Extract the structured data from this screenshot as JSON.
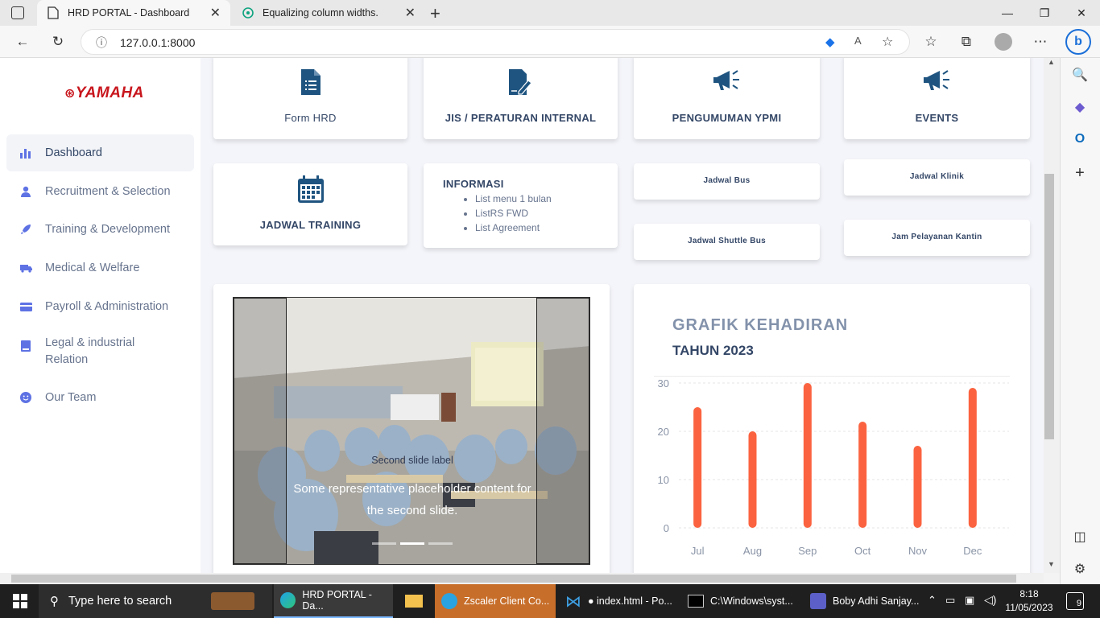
{
  "browser": {
    "tabs": [
      {
        "title": "HRD PORTAL - Dashboard",
        "active": true
      },
      {
        "title": "Equalizing column widths.",
        "active": false
      }
    ],
    "url": "127.0.0.1:8000",
    "url_port_suffix": ""
  },
  "sidebar": {
    "logo": "YAMAHA",
    "items": [
      {
        "label": "Dashboard",
        "icon": "bar-chart-icon",
        "active": true
      },
      {
        "label": "Recruitment & Selection",
        "icon": "person-icon"
      },
      {
        "label": "Training & Development",
        "icon": "rocket-icon"
      },
      {
        "label": "Medical & Welfare",
        "icon": "ambulance-icon"
      },
      {
        "label": "Payroll & Administration",
        "icon": "card-icon"
      },
      {
        "label": "Legal & industrial Relation",
        "icon": "book-icon"
      },
      {
        "label": "Our Team",
        "icon": "smile-icon"
      }
    ]
  },
  "cards": {
    "form_hrd": "Form HRD",
    "jis": "JIS / PERATURAN INTERNAL",
    "pengumuman": "PENGUMUMAN YPMI",
    "events": "EVENTS",
    "jadwal_training": "JADWAL TRAINING",
    "informasi": {
      "title": "INFORMASI",
      "items": [
        "List menu 1 bulan",
        "ListRS FWD",
        "List Agreement"
      ]
    },
    "jadwal_bus": "Jadwal Bus",
    "jadwal_klinik": "Jadwal Klinik",
    "jadwal_shuttle": "Jadwal Shuttle Bus",
    "jam_kantin": "Jam Pelayanan Kantin"
  },
  "carousel": {
    "label": "Second slide label",
    "caption": "Some representative placeholder content for the second slide.",
    "indicators": 3,
    "active_index": 1
  },
  "chart_data": {
    "type": "bar",
    "title": "GRAFIK KEHADIRAN",
    "subtitle": "TAHUN 2023",
    "categories": [
      "Jul",
      "Aug",
      "Sep",
      "Oct",
      "Nov",
      "Dec"
    ],
    "values": [
      25,
      20,
      30,
      22,
      17,
      29
    ],
    "ylim": [
      0,
      30
    ],
    "yticks": [
      0,
      10,
      20,
      30
    ],
    "color": "#fb6340",
    "grid": true
  },
  "taskbar": {
    "search_placeholder": "Type here to search",
    "apps": [
      {
        "label": "HRD PORTAL - Da..."
      },
      {
        "label": "Zscaler Client Co..."
      },
      {
        "label": "● index.html - Po..."
      },
      {
        "label": "C:\\Windows\\syst..."
      },
      {
        "label": "Boby Adhi Sanjay..."
      }
    ],
    "time": "8:18",
    "date": "11/05/2023",
    "notifications": "9"
  }
}
